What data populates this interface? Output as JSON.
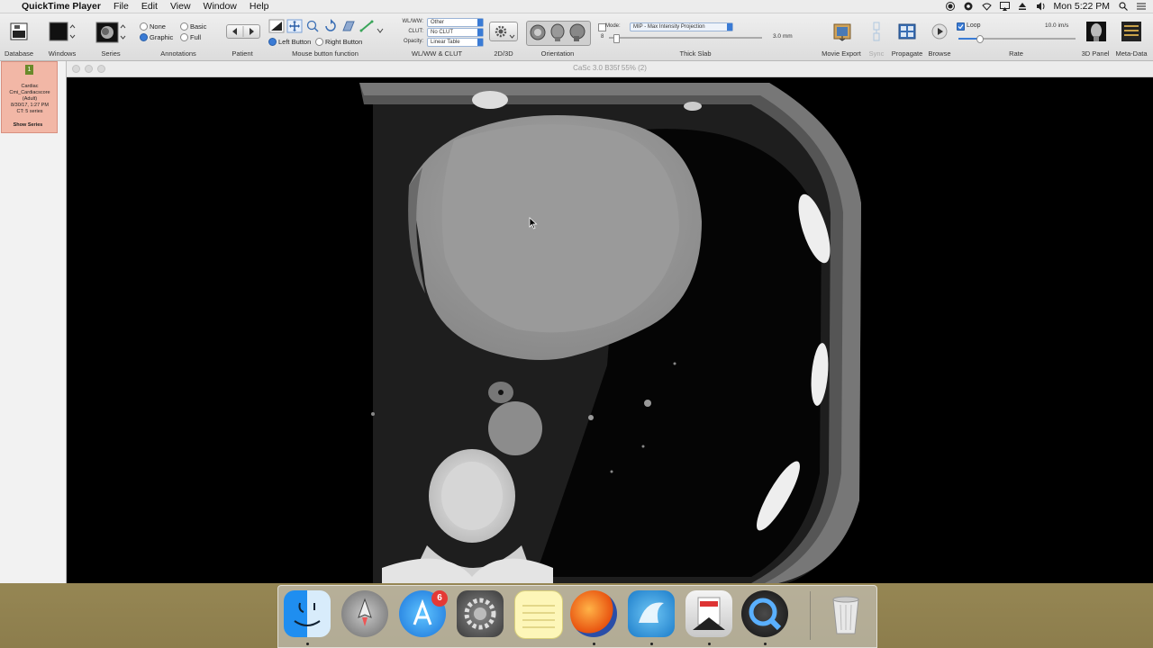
{
  "menubar": {
    "app_name": "QuickTime Player",
    "items": [
      "File",
      "Edit",
      "View",
      "Window",
      "Help"
    ],
    "clock": "Mon 5:22 PM"
  },
  "toolbar": {
    "labels": {
      "database": "Database",
      "windows": "Windows",
      "series": "Series",
      "annotations": "Annotations",
      "patient": "Patient",
      "mouse_button_function": "Mouse button function",
      "wl_ww_clut": "WL/WW & CLUT",
      "twod_threed": "2D/3D",
      "orientation": "Orientation",
      "thick_slab": "Thick Slab",
      "movie_export": "Movie Export",
      "sync": "Sync",
      "propagate": "Propagate",
      "browse": "Browse",
      "rate": "Rate",
      "panel_3d": "3D Panel",
      "meta_data": "Meta-Data"
    },
    "annotations_options": {
      "none": "None",
      "graphic": "Graphic",
      "basic": "Basic",
      "full": "Full",
      "selected": "Graphic"
    },
    "mouse_buttons": {
      "left": "Left Button",
      "right": "Right Button",
      "selected": "Left Button"
    },
    "wlww": {
      "wlww_label": "WL/WW:",
      "wlww_value": "Other",
      "clut_label": "CLUT:",
      "clut_value": "No CLUT",
      "opacity_label": "Opacity:",
      "opacity_value": "Linear Table"
    },
    "thick_slab": {
      "mode_label": "Mode:",
      "mode_value": "MIP - Max Intensity Projection",
      "slab_count": "8",
      "thickness": "3.0 mm"
    },
    "rate": {
      "loop_label": "Loop",
      "loop_checked": true,
      "rate_value": "10.0 im/s"
    }
  },
  "sidebar": {
    "series_number": "1",
    "series_lines": [
      "Cardiac",
      "Cmi_Cardiacscore",
      "(Adult)",
      "8/30/17, 1:27 PM",
      "CT: 5 series"
    ],
    "show_series": "Show Series"
  },
  "viewer": {
    "title": "CaSc 3.0 B35f 55% (2)"
  },
  "dock": {
    "app_store_badge": "6",
    "apps": [
      "finder",
      "launchpad",
      "app-store",
      "system-preferences",
      "notes",
      "firefox",
      "osirix",
      "pdf-tool",
      "quicktime",
      "trash"
    ]
  }
}
